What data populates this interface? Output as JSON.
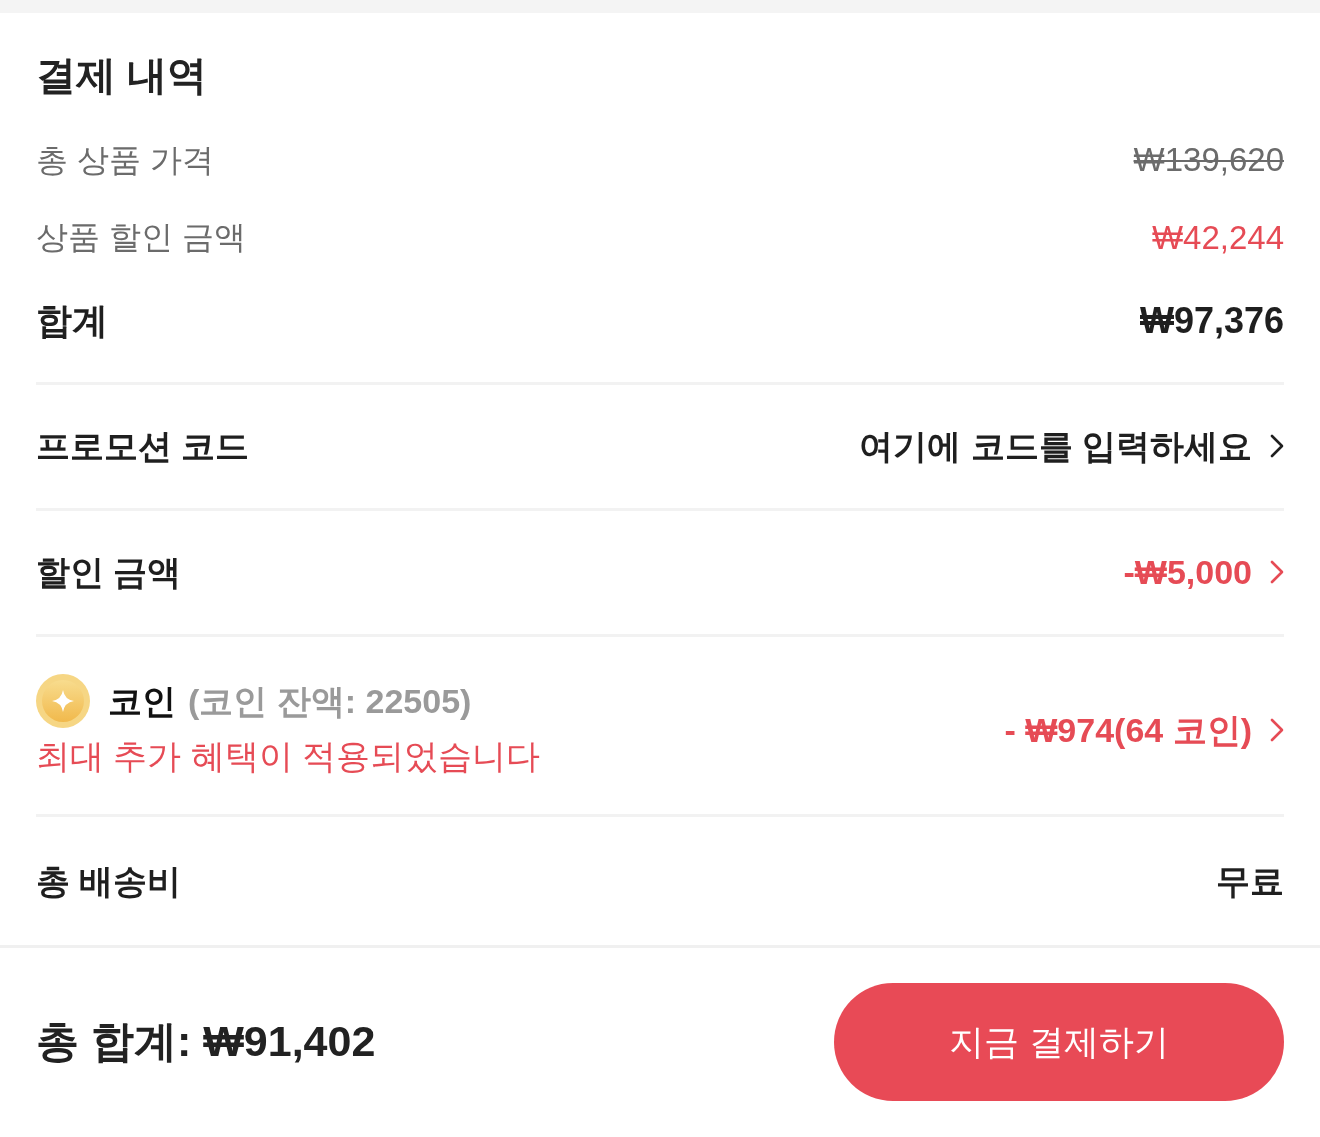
{
  "title": "결제 내역",
  "summary": [
    {
      "kind": "original",
      "label": "총 상품 가격",
      "value": "₩139,620"
    },
    {
      "kind": "discount",
      "label": "상품 할인 금액",
      "value": "₩42,244"
    },
    {
      "kind": "total",
      "label": "합계",
      "value": "₩97,376"
    }
  ],
  "rows": [
    {
      "kind": "text",
      "label": "프로모션 코드",
      "value": "여기에 코드를 입력하세요",
      "chevron": true
    },
    {
      "kind": "deduction",
      "label": "할인 금액",
      "value": "-₩5,000",
      "chevron": true
    },
    {
      "kind": "coin",
      "label": "코인",
      "balance": "(코인 잔액: 22505)",
      "note": "최대 추가 혜택이 적용되었습니다",
      "value": "- ₩974(64 코인)",
      "chevron": true
    },
    {
      "kind": "text",
      "label": "총 배송비",
      "value": "무료",
      "chevron": false
    }
  ],
  "footer": {
    "total": "총 합계: ₩91,402",
    "button": "지금 결제하기"
  }
}
